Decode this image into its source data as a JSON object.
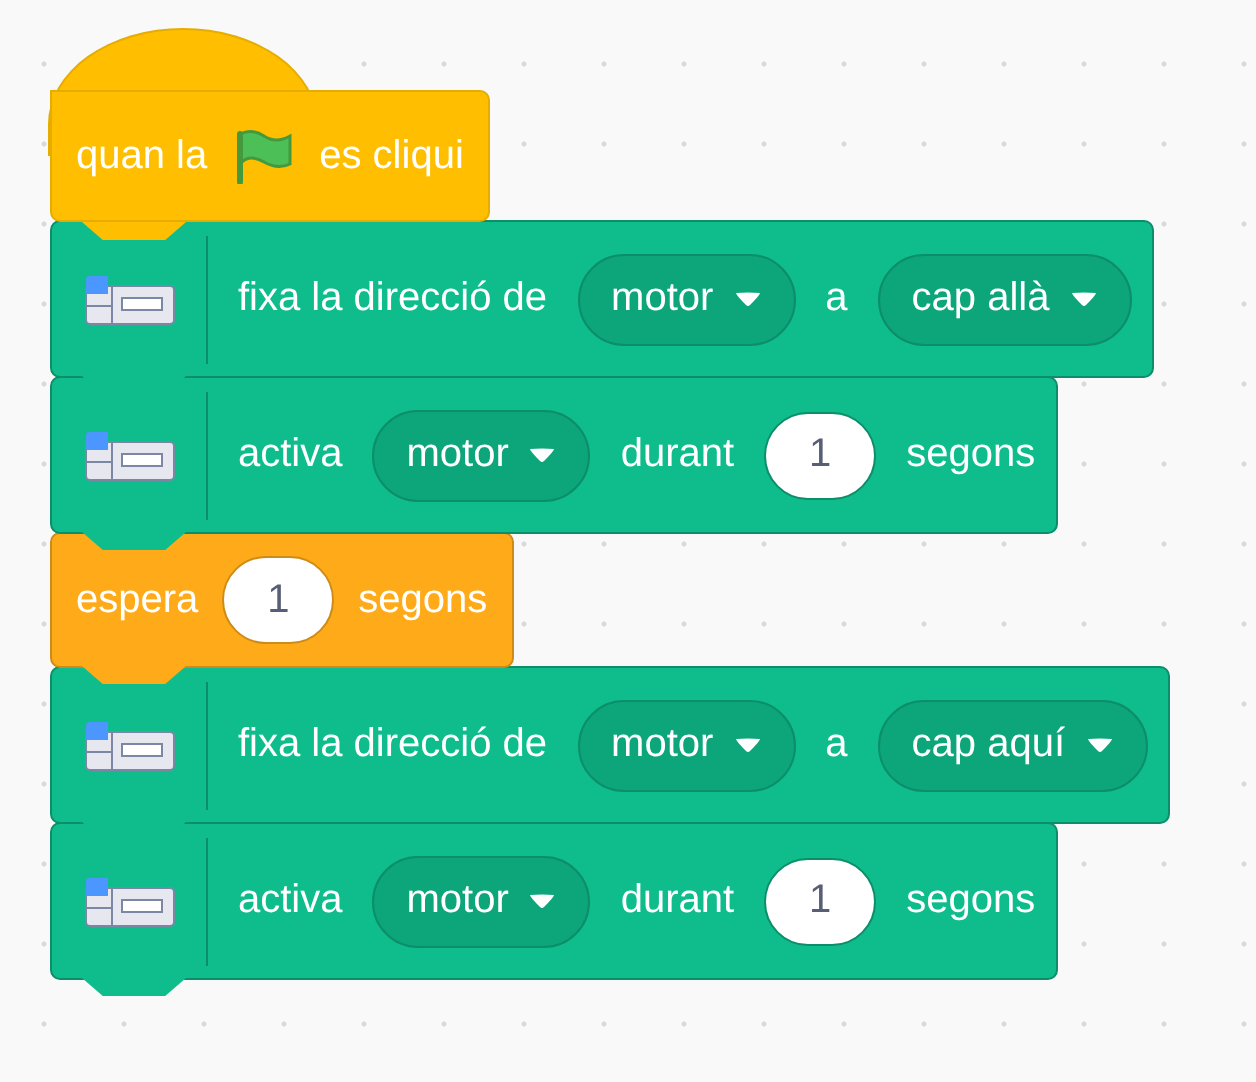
{
  "script": [
    {
      "kind": "hat",
      "parts": [
        {
          "kind": "text",
          "text": "quan la"
        },
        {
          "kind": "flag"
        },
        {
          "kind": "text",
          "text": "es cliqui"
        }
      ]
    },
    {
      "kind": "motor",
      "parts": [
        {
          "kind": "text",
          "text": "fixa la direcció de"
        },
        {
          "kind": "dropdown",
          "text": "motor"
        },
        {
          "kind": "text",
          "text": "a"
        },
        {
          "kind": "dropdown",
          "text": "cap allà"
        }
      ]
    },
    {
      "kind": "motor",
      "parts": [
        {
          "kind": "text",
          "text": "activa"
        },
        {
          "kind": "dropdown",
          "text": "motor"
        },
        {
          "kind": "text",
          "text": "durant"
        },
        {
          "kind": "number",
          "text": "1"
        },
        {
          "kind": "text",
          "text": "segons"
        }
      ]
    },
    {
      "kind": "wait",
      "parts": [
        {
          "kind": "text",
          "text": "espera"
        },
        {
          "kind": "number",
          "text": "1"
        },
        {
          "kind": "text",
          "text": "segons"
        }
      ]
    },
    {
      "kind": "motor",
      "parts": [
        {
          "kind": "text",
          "text": "fixa la direcció de"
        },
        {
          "kind": "dropdown",
          "text": "motor"
        },
        {
          "kind": "text",
          "text": "a"
        },
        {
          "kind": "dropdown",
          "text": "cap aquí"
        }
      ]
    },
    {
      "kind": "motor",
      "parts": [
        {
          "kind": "text",
          "text": "activa"
        },
        {
          "kind": "dropdown",
          "text": "motor"
        },
        {
          "kind": "text",
          "text": "durant"
        },
        {
          "kind": "number",
          "text": "1"
        },
        {
          "kind": "text",
          "text": "segons"
        }
      ]
    }
  ]
}
